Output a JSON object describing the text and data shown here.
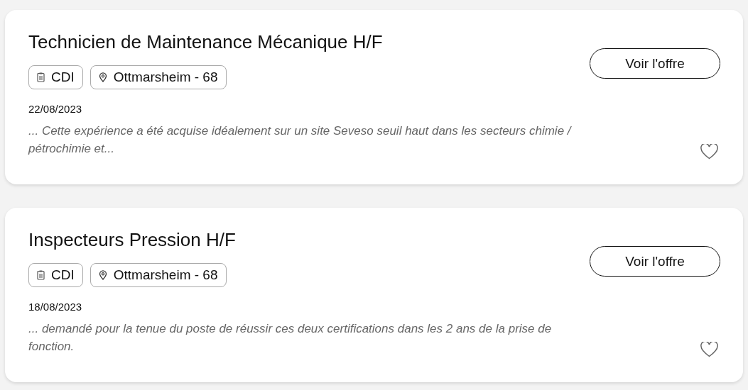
{
  "offers": [
    {
      "title": "Technicien de Maintenance Mécanique H/F",
      "contract": "CDI",
      "location": "Ottmarsheim - 68",
      "date": "22/08/2023",
      "excerpt": "... Cette expérience a été acquise idéalement sur un site Seveso seuil haut dans les secteurs chimie / pétrochimie et...",
      "button": "Voir l'offre",
      "favorite": false
    },
    {
      "title": "Inspecteurs Pression H/F",
      "contract": "CDI",
      "location": "Ottmarsheim - 68",
      "date": "18/08/2023",
      "excerpt": "... demandé pour la tenue du poste de réussir ces deux certifications dans les 2 ans de la prise de fonction.",
      "button": "Voir l'offre",
      "favorite": false
    }
  ]
}
